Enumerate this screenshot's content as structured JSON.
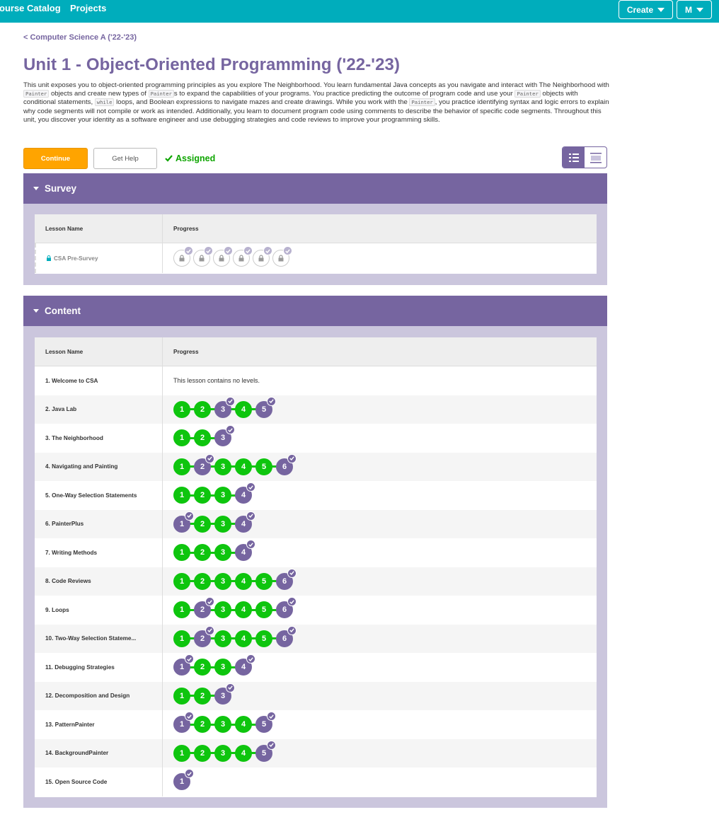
{
  "nav": {
    "catalog": "ourse Catalog",
    "projects": "Projects",
    "create": "Create",
    "user": "M"
  },
  "breadcrumb": "< Computer Science A ('22-'23)",
  "title": "Unit 1 - Object-Oriented Programming ('22-'23)",
  "description": {
    "t1": "This unit exposes you to object-oriented programming principles as you explore The Neighborhood. You learn fundamental Java concepts as you navigate and interact with The Neighborhood with ",
    "c1": "Painter",
    "t2": " objects and create new types of ",
    "c2": "Painter",
    "t3": "s to expand the capabilities of your programs. You practice predicting the outcome of program code and use your ",
    "c3": "Painter",
    "t4": " objects with conditional statements, ",
    "c4": "while",
    "t5": " loops, and Boolean expressions to navigate mazes and create drawings. While you work with the ",
    "c5": "Painter",
    "t6": ", you practice identifying syntax and logic errors to explain why code segments will not compile or work as intended. Additionally, you learn to document program code using comments to describe the behavior of specific code segments. Throughout this unit, you discover your identity as a software engineer and use debugging strategies and code reviews to improve your programming skills."
  },
  "actions": {
    "continue": "Continue",
    "get_help": "Get Help",
    "assigned": "Assigned"
  },
  "colors": {
    "teal": "#00adbc",
    "purple": "#7665a0",
    "green": "#0ec50e",
    "orange": "#ffa400"
  },
  "survey": {
    "header": "Survey",
    "col_name": "Lesson Name",
    "col_progress": "Progress",
    "lesson": "CSA Pre-Survey",
    "locked_levels": 6
  },
  "content": {
    "header": "Content",
    "col_name": "Lesson Name",
    "col_progress": "Progress",
    "no_levels_text": "This lesson contains no levels.",
    "lessons": [
      {
        "name": "1. Welcome to CSA",
        "levels": []
      },
      {
        "name": "2. Java Lab",
        "levels": [
          "g",
          "g",
          "p",
          "g",
          "p"
        ]
      },
      {
        "name": "3. The Neighborhood",
        "levels": [
          "g",
          "g",
          "p"
        ]
      },
      {
        "name": "4. Navigating and Painting",
        "levels": [
          "g",
          "p",
          "g",
          "g",
          "g",
          "p"
        ]
      },
      {
        "name": "5. One-Way Selection Statements",
        "levels": [
          "g",
          "g",
          "g",
          "p"
        ]
      },
      {
        "name": "6. PainterPlus",
        "levels": [
          "p",
          "g",
          "g",
          "p"
        ]
      },
      {
        "name": "7. Writing Methods",
        "levels": [
          "g",
          "g",
          "g",
          "p"
        ]
      },
      {
        "name": "8. Code Reviews",
        "levels": [
          "g",
          "g",
          "g",
          "g",
          "g",
          "p"
        ]
      },
      {
        "name": "9. Loops",
        "levels": [
          "g",
          "p",
          "g",
          "g",
          "g",
          "p"
        ]
      },
      {
        "name": "10. Two-Way Selection Stateme...",
        "levels": [
          "g",
          "p",
          "g",
          "g",
          "g",
          "p"
        ]
      },
      {
        "name": "11. Debugging Strategies",
        "levels": [
          "p",
          "g",
          "g",
          "p"
        ]
      },
      {
        "name": "12. Decomposition and Design",
        "levels": [
          "g",
          "g",
          "p"
        ]
      },
      {
        "name": "13. PatternPainter",
        "levels": [
          "p",
          "g",
          "g",
          "g",
          "p"
        ]
      },
      {
        "name": "14. BackgroundPainter",
        "levels": [
          "g",
          "g",
          "g",
          "g",
          "p"
        ]
      },
      {
        "name": "15. Open Source Code",
        "levels": [
          "p"
        ]
      }
    ]
  }
}
